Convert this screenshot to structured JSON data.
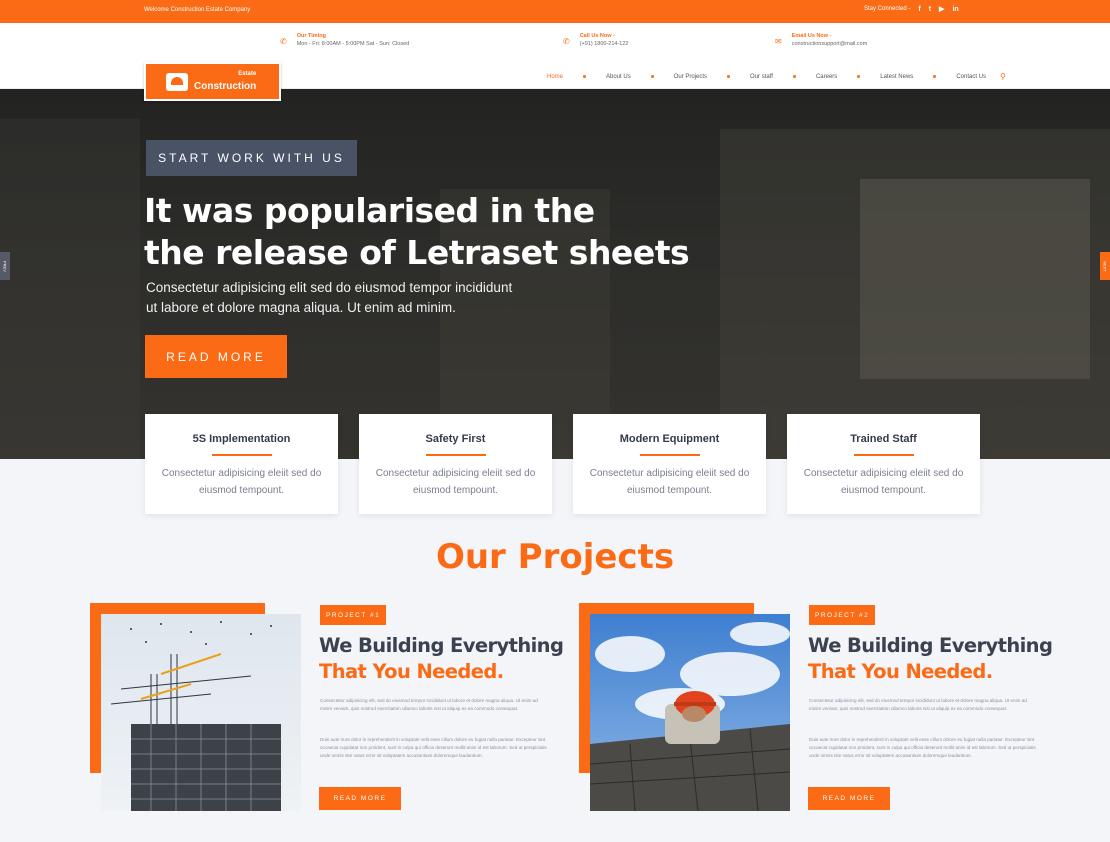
{
  "topbar": {
    "welcome": "Welcome Construction Estate Company",
    "stay_connected": "Stay Connected -",
    "social": [
      {
        "icon": "facebook-icon",
        "glyph": "f"
      },
      {
        "icon": "twitter-icon",
        "glyph": "t"
      },
      {
        "icon": "youtube-icon",
        "glyph": "▶"
      },
      {
        "icon": "linkedin-icon",
        "glyph": "in"
      }
    ]
  },
  "info": [
    {
      "icon": "phone-icon",
      "glyph": "✆",
      "title": "Our Timing",
      "value": "Mon - Fri: 8:00AM - 5:00PM  Sat - Sun: Closed"
    },
    {
      "icon": "phone-icon",
      "glyph": "✆",
      "title": "Call Us Now -",
      "value": "(+91) 1800-214-122"
    },
    {
      "icon": "mail-icon",
      "glyph": "✉",
      "title": "Email Us Now -",
      "value": "constructionsupport@mail.com"
    }
  ],
  "logo": {
    "small": "Estate",
    "big": "Construction"
  },
  "nav": [
    {
      "label": "Home",
      "active": true
    },
    {
      "label": "About Us"
    },
    {
      "label": "Our Projects"
    },
    {
      "label": "Our staff"
    },
    {
      "label": "Careers"
    },
    {
      "label": "Latest News"
    },
    {
      "label": "Contact Us"
    }
  ],
  "hero": {
    "tag": "START WORK WITH US",
    "title_line1": "It was popularised in the",
    "title_line2": "the release of Letraset sheets",
    "sub_line1": "Consectetur adipisicing elit sed do eiusmod tempor incididunt",
    "sub_line2": "ut labore et dolore magna aliqua. Ut enim ad minim.",
    "button": "READ MORE",
    "prev": "PREV",
    "next": "NEXT"
  },
  "features": [
    {
      "title": "5S Implementation",
      "text": "Consectetur adipisicing eleiit sed do eiusmod tempount."
    },
    {
      "title": "Safety First",
      "text": "Consectetur adipisicing eleiit sed do eiusmod tempount."
    },
    {
      "title": "Modern Equipment",
      "text": "Consectetur adipisicing eleiit sed do eiusmod tempount."
    },
    {
      "title": "Trained Staff",
      "text": "Consectetur adipisicing eleiit sed do eiusmod tempount."
    }
  ],
  "projects_section": {
    "title": "Our Projects",
    "items": [
      {
        "badge": "PROJECT #1",
        "title_line1": "We Building Everything",
        "title_line2": "That You Needed.",
        "para1": "Consectetur adipisicing elit, sed do eiusmod tempor incididunt ut labore et dolore magna aliqua. Ut enim ad minim veniam, quis nostrud exercitation ullamco laboris nisi ut aliquip ex ea commodo consequat.",
        "para2": "Duis aute irure dolor in reprehenderit in voluptate velit esse cillum dolore eu fugiat nulla pariatur. Excepteur sint occaecat cupidatat non proident, sunt in culpa qui officia deserunt mollit anim id est laborum. Sed ut perspiciatis unde omnis iste natus error sit voluptatem accusantium doloremque laudantium.",
        "button": "READ MORE"
      },
      {
        "badge": "PROJECT #2",
        "title_line1": "We Building Everything",
        "title_line2": "That You Needed.",
        "para1": "Consectetur adipisicing elit, sed do eiusmod tempor incididunt ut labore et dolore magna aliqua. Ut enim ad minim veniam, quis nostrud exercitation ullamco laboris nisi ut aliquip ex ea commodo consequat.",
        "para2": "Duis aute irure dolor in reprehenderit in voluptate velit esse cillum dolore eu fugiat nulla pariatur. Excepteur sint occaecat cupidatat non proident, sunt in culpa qui officia deserunt mollit anim id est laborum. Sed ut perspiciatis unde omnis iste natus error sit voluptatem accusantium doloremque laudantium.",
        "button": "READ MORE"
      }
    ]
  },
  "colors": {
    "accent": "#fb6b15",
    "dark": "#3c4150",
    "tag_bg": "#4a5265"
  }
}
